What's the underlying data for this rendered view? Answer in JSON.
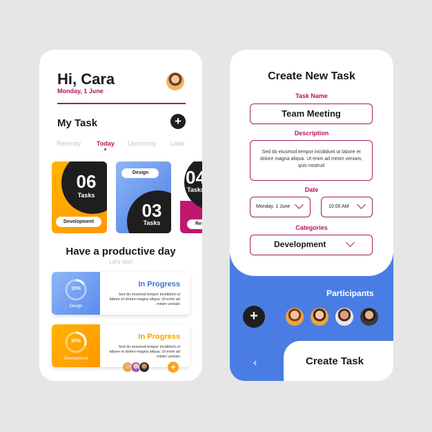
{
  "home": {
    "greeting": "Hi, Cara",
    "date": "Monday, 1 June",
    "section_title": "My Task",
    "add_symbol": "+",
    "tabs": [
      {
        "label": "Recently"
      },
      {
        "label": "Today"
      },
      {
        "label": "Upcoming"
      },
      {
        "label": "Later"
      }
    ],
    "cards": [
      {
        "count": "06",
        "unit": "Tasks",
        "tag": "Development",
        "color": "#ffa000"
      },
      {
        "count": "03",
        "unit": "Tasks",
        "tag": "Design",
        "color": "#5b8cf0"
      },
      {
        "count": "04",
        "unit": "Tasks",
        "tag": "Research",
        "color": "#c2186b"
      }
    ],
    "motto": "Have a productive day",
    "motto_sub": "Let's start",
    "progress": [
      {
        "title": "In Progress",
        "percent_label": "15%",
        "percent": 15,
        "category": "Design",
        "description": "Sed do eiusmod tempor incididunt ut labore et dolore magna aliqua. Ut enim ad minim veniam",
        "color": "#3a72dc"
      },
      {
        "title": "In Progress",
        "percent_label": "30%",
        "percent": 30,
        "category": "Development",
        "description": "Sed do eiusmod tempor incididunt ut labore et dolore magna aliqua. Ut enim ad minim veniam",
        "color": "#f5a300"
      }
    ],
    "small_add_symbol": "+"
  },
  "create": {
    "title": "Create New Task",
    "task_name_label": "Task Name",
    "task_name_value": "Team Meeting",
    "description_label": "Description",
    "description_value": "Sed do eiusmod tempor incididunt ut labore et dolore magna aliqua. Ut enim ad minim veniam, quis nostrud",
    "date_label": "Date",
    "date_value": "Monday, 1 June",
    "time_value": "10:00  AM",
    "categories_label": "Categories",
    "category_value": "Development",
    "participants_label": "Participants",
    "add_symbol": "+",
    "back_symbol": "‹",
    "create_button": "Create Task"
  }
}
